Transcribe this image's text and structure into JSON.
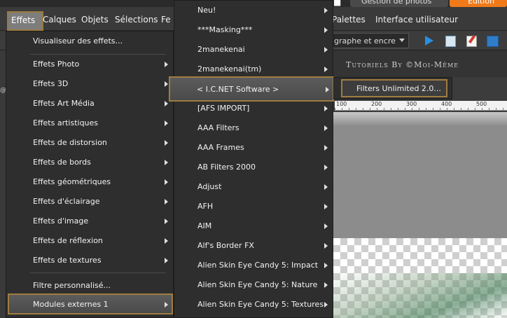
{
  "workspace_tabs": {
    "photo": "Gestion de photos",
    "edit": "Édition"
  },
  "menubar": {
    "items": [
      "Effets",
      "Calques",
      "Objets",
      "Sélections",
      "Fe",
      "Palettes",
      "Interface utilisateur"
    ]
  },
  "toolbar": {
    "combo_value": "graphe et encre"
  },
  "canvas_title": "Tutoriels By ©Moi-Même",
  "ruler_ticks": [
    "100",
    "200",
    "300",
    "400",
    "500"
  ],
  "left_strip_text": "@",
  "effects_menu": {
    "items": [
      {
        "label": "Visualiseur des effets...",
        "submenu": false
      },
      {
        "label": "Effets Photo",
        "submenu": true
      },
      {
        "label": "Effets 3D",
        "submenu": true
      },
      {
        "label": "Effets Art Média",
        "submenu": true
      },
      {
        "label": "Effets artistiques",
        "submenu": true
      },
      {
        "label": "Effets de distorsion",
        "submenu": true
      },
      {
        "label": "Effets de bords",
        "submenu": true
      },
      {
        "label": "Effets géométriques",
        "submenu": true
      },
      {
        "label": "Effets d'éclairage",
        "submenu": true
      },
      {
        "label": "Effets d'image",
        "submenu": true
      },
      {
        "label": "Effets de réflexion",
        "submenu": true
      },
      {
        "label": "Effets de textures",
        "submenu": true
      },
      {
        "label": "Filtre personnalisé...",
        "submenu": false
      },
      {
        "label": "Modules externes 1",
        "submenu": true,
        "highlighted": true
      }
    ]
  },
  "plugins_menu": {
    "items": [
      {
        "label": "Neu!",
        "submenu": true
      },
      {
        "label": "***Masking***",
        "submenu": true
      },
      {
        "label": "2manekenai",
        "submenu": true
      },
      {
        "label": "2manekenai(tm)",
        "submenu": true
      },
      {
        "label": "< I.C.NET Software >",
        "submenu": true,
        "highlighted": true
      },
      {
        "label": "[AFS IMPORT]",
        "submenu": true
      },
      {
        "label": "AAA Filters",
        "submenu": true
      },
      {
        "label": "AAA Frames",
        "submenu": true
      },
      {
        "label": "AB Filters 2000",
        "submenu": true
      },
      {
        "label": "Adjust",
        "submenu": true
      },
      {
        "label": "AFH",
        "submenu": true
      },
      {
        "label": "AIM",
        "submenu": true
      },
      {
        "label": "Alf's Border FX",
        "submenu": true
      },
      {
        "label": "Alien Skin Eye Candy 5: Impact",
        "submenu": true
      },
      {
        "label": "Alien Skin Eye Candy 5: Nature",
        "submenu": true
      },
      {
        "label": "Alien Skin Eye Candy 5: Textures",
        "submenu": true
      }
    ]
  },
  "icnet_menu": {
    "items": [
      {
        "label": "Filters Unlimited 2.0...",
        "highlighted": true
      }
    ]
  },
  "colors": {
    "highlight_border": "#a07c40",
    "menu_bg": "#2e2e2e",
    "accent_orange": "#f07a1a"
  }
}
